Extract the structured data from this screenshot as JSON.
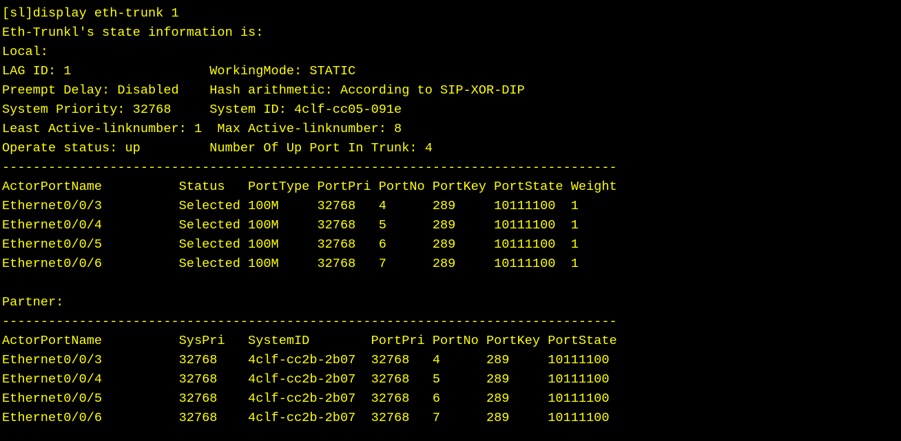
{
  "terminal": {
    "colors": {
      "background": "#000000",
      "text": "#ffff00"
    },
    "lines": [
      "[sl]display eth-trunk 1",
      "Eth-Trunkl's state information is:",
      "Local:",
      "LAG ID: 1                  WorkingMode: STATIC",
      "Preempt Delay: Disabled    Hash arithmetic: According to SIP-XOR-DIP",
      "System Priority: 32768     System ID: 4clf-cc05-091e",
      "Least Active-linknumber: 1  Max Active-linknumber: 8",
      "Operate status: up         Number Of Up Port In Trunk: 4",
      "--------------------------------------------------------------------------------",
      "ActorPortName          Status   PortType PortPri PortNo PortKey PortState Weight",
      "Ethernet0/0/3          Selected 100M     32768   4      289     10111100  1",
      "Ethernet0/0/4          Selected 100M     32768   5      289     10111100  1",
      "Ethernet0/0/5          Selected 100M     32768   6      289     10111100  1",
      "Ethernet0/0/6          Selected 100M     32768   7      289     10111100  1",
      "",
      "Partner:",
      "--------------------------------------------------------------------------------",
      "ActorPortName          SysPri   SystemID        PortPri PortNo PortKey PortState",
      "Ethernet0/0/3          32768    4clf-cc2b-2b07  32768   4      289     10111100",
      "Ethernet0/0/4          32768    4clf-cc2b-2b07  32768   5      289     10111100",
      "Ethernet0/0/5          32768    4clf-cc2b-2b07  32768   6      289     10111100",
      "Ethernet0/0/6          32768    4clf-cc2b-2b07  32768   7      289     10111100"
    ]
  }
}
